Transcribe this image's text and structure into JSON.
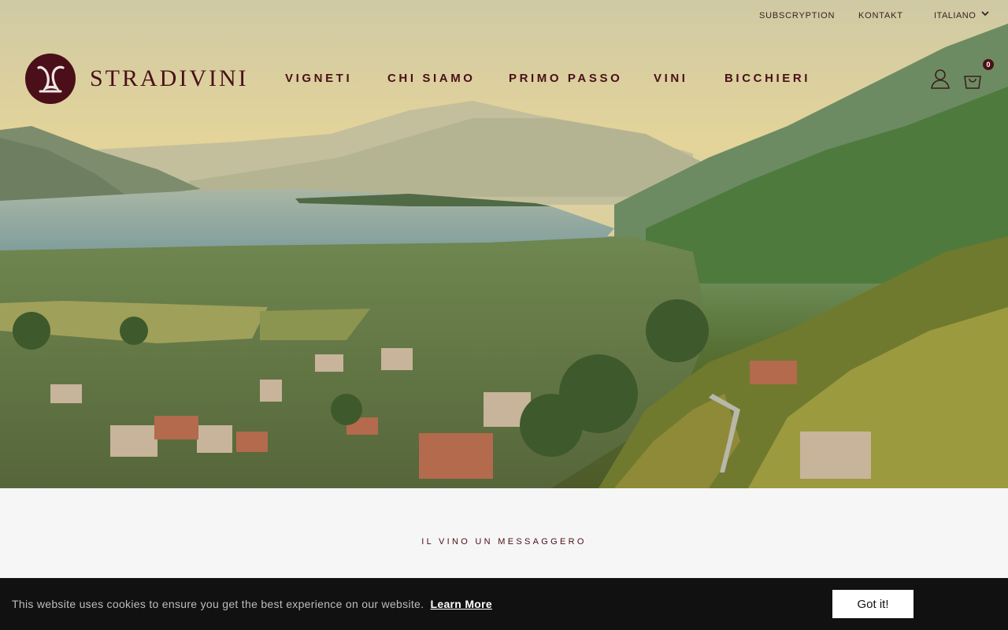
{
  "header": {
    "utility_links": [
      {
        "label": "SUBSCRYPTION"
      },
      {
        "label": "KONTAKT"
      }
    ],
    "language": {
      "selected": "ITALIANO"
    },
    "logo": {
      "wordmark": "STRADIVINI"
    },
    "nav": [
      {
        "label": "VIGNETI"
      },
      {
        "label": "CHI SIAMO"
      },
      {
        "label": "PRIMO PASSO"
      },
      {
        "label": "VINI"
      },
      {
        "label": "BICCHIERI"
      }
    ],
    "icons": {
      "account": "user-icon",
      "cart": "shopping-bag-icon"
    },
    "cart_count": "0"
  },
  "main": {
    "section_heading": "IL VINO UN MESSAGGERO"
  },
  "cookie_banner": {
    "message": "This website uses cookies to ensure you get the best experience on our website.",
    "learn_more": "Learn More",
    "accept": "Got it!"
  },
  "colors": {
    "brand": "#4a0f18",
    "cookie_bg": "#111111"
  }
}
